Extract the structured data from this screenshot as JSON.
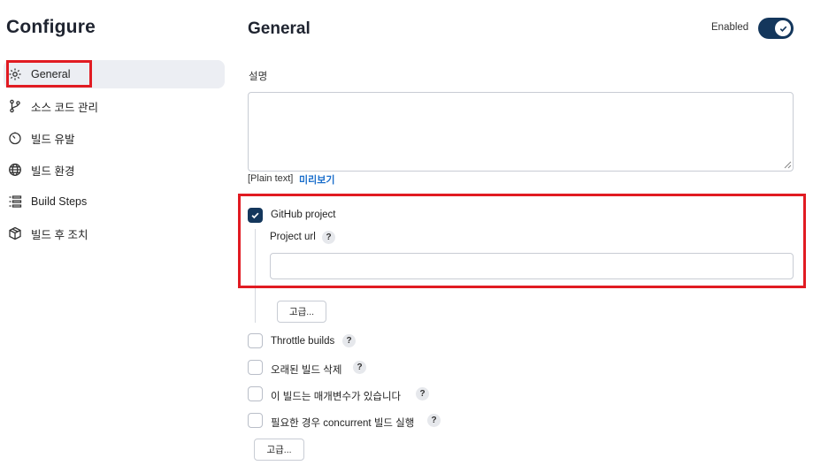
{
  "page": {
    "title": "Configure"
  },
  "sidebar": {
    "items": [
      {
        "label": "General",
        "icon": "gear-icon",
        "active": true
      },
      {
        "label": "소스 코드 관리",
        "icon": "branch-icon"
      },
      {
        "label": "빌드 유발",
        "icon": "timer-icon"
      },
      {
        "label": "빌드 환경",
        "icon": "globe-icon"
      },
      {
        "label": "Build Steps",
        "icon": "list-icon"
      },
      {
        "label": "빌드 후 조치",
        "icon": "package-icon"
      }
    ]
  },
  "general": {
    "title": "General",
    "enabled_label": "Enabled",
    "enabled": true,
    "description_label": "설명",
    "description_value": "",
    "plain_text": "[Plain text]",
    "preview_link": "미리보기"
  },
  "github_project": {
    "label": "GitHub project",
    "checked": true,
    "url_label": "Project url",
    "url_value": "",
    "advanced_label": "고급..."
  },
  "options": [
    {
      "label": "Throttle builds",
      "checked": false
    },
    {
      "label": "오래된 빌드 삭제",
      "checked": false
    },
    {
      "label": "이 빌드는 매개변수가 있습니다",
      "checked": false
    },
    {
      "label": "필요한 경우 concurrent 빌드 실행",
      "checked": false
    }
  ],
  "help_glyph": "?",
  "advanced_label": "고급...",
  "colors": {
    "accent": "#14375c",
    "highlight": "#e11b22",
    "link": "#1a6ecb"
  }
}
